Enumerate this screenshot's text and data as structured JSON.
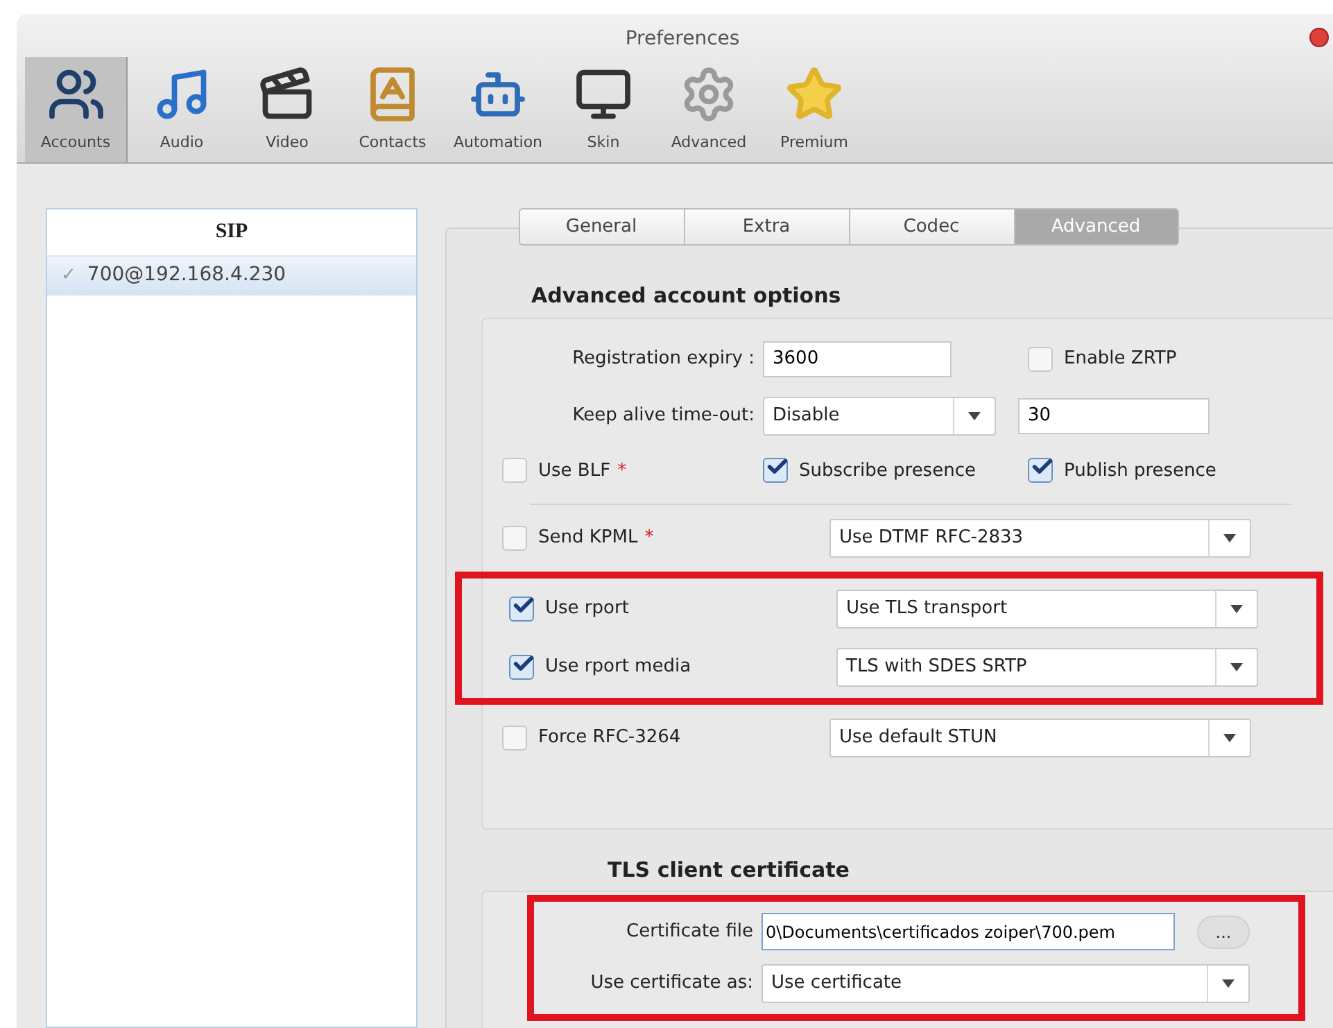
{
  "window": {
    "title": "Preferences"
  },
  "toolbar": [
    {
      "label": "Accounts",
      "kind": "accounts",
      "selected": true
    },
    {
      "label": "Audio",
      "kind": "audio",
      "selected": false
    },
    {
      "label": "Video",
      "kind": "video",
      "selected": false
    },
    {
      "label": "Contacts",
      "kind": "contacts",
      "selected": false
    },
    {
      "label": "Automation",
      "kind": "automation",
      "selected": false
    },
    {
      "label": "Skin",
      "kind": "skin",
      "selected": false
    },
    {
      "label": "Advanced",
      "kind": "advanced",
      "selected": false
    },
    {
      "label": "Premium",
      "kind": "premium",
      "selected": false
    }
  ],
  "accounts_list": {
    "header": "SIP",
    "items": [
      {
        "label": "700@192.168.4.230",
        "mark": "✓",
        "selected": true
      }
    ]
  },
  "tabs": [
    {
      "label": "General",
      "selected": false
    },
    {
      "label": "Extra",
      "selected": false
    },
    {
      "label": "Codec",
      "selected": false
    },
    {
      "label": "Advanced",
      "selected": true
    }
  ],
  "advanced": {
    "title": "Advanced account options",
    "registration": {
      "label": "Registration expiry :",
      "value": "3600",
      "checkbox": {
        "label": "Enable ZRTP",
        "checked": false
      }
    },
    "keep_alive": {
      "label": "Keep alive time-out:",
      "select": "Disable",
      "value": "30"
    },
    "checkboxes": [
      {
        "label": "Use BLF",
        "mark": "*",
        "checked": false
      },
      {
        "label": "Subscribe presence",
        "checked": true
      },
      {
        "label": "Publish presence",
        "checked": true
      }
    ],
    "select_groups": [
      {
        "highlighted": false,
        "rows": [
          {
            "label": "Send KPML",
            "mark": "*",
            "checked": false,
            "select": "Use DTMF RFC-2833"
          }
        ]
      },
      {
        "highlighted": true,
        "rows": [
          {
            "label": "Use rport",
            "checked": true,
            "select": "Use TLS transport"
          },
          {
            "label": "Use rport media",
            "checked": true,
            "select": "TLS with SDES SRTP"
          }
        ]
      },
      {
        "highlighted": false,
        "rows": [
          {
            "label": "Force RFC-3264",
            "checked": false,
            "select": "Use default STUN"
          }
        ]
      }
    ]
  },
  "tls": {
    "title": "TLS client certificate",
    "highlighted": true,
    "certificate_file": {
      "label": "Certificate file",
      "value": "0\\Documents\\certificados zoiper\\700.pem"
    },
    "browse_button": "...",
    "use_as": {
      "label": "Use certificate as:",
      "select": "Use certificate"
    }
  }
}
